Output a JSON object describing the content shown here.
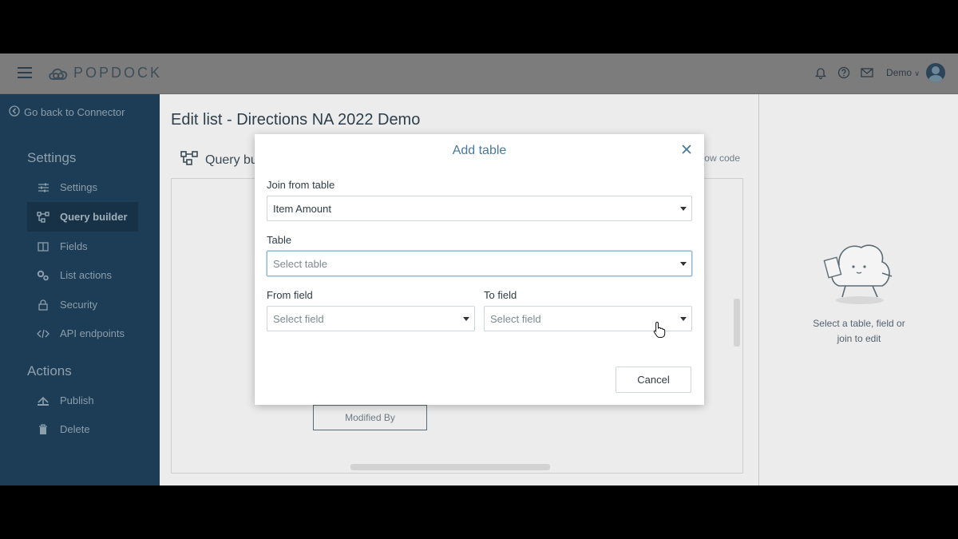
{
  "app": {
    "logo_text": "POPDOCK",
    "user_name": "Demo",
    "user_menu_caret": "∨"
  },
  "sidebar": {
    "back_label": "Go back to Connector",
    "settings_title": "Settings",
    "items": [
      {
        "label": "Settings",
        "icon": "sliders-icon"
      },
      {
        "label": "Query builder",
        "icon": "query-builder-icon",
        "active": true
      },
      {
        "label": "Fields",
        "icon": "columns-icon"
      },
      {
        "label": "List actions",
        "icon": "gears-icon"
      },
      {
        "label": "Security",
        "icon": "lock-icon"
      },
      {
        "label": "API endpoints",
        "icon": "code-icon"
      }
    ],
    "actions_title": "Actions",
    "actions": [
      {
        "label": "Publish",
        "icon": "publish-icon"
      },
      {
        "label": "Delete",
        "icon": "trash-icon"
      }
    ]
  },
  "main": {
    "page_title": "Edit list - Directions NA 2022 Demo",
    "panel_title": "Query bu",
    "show_code": "ow code",
    "node_label": "Modified By"
  },
  "right_panel": {
    "empty_text_line1": "Select a table, field or",
    "empty_text_line2": "join to edit"
  },
  "modal": {
    "title": "Add table",
    "join_from_label": "Join from table",
    "join_from_value": "Item Amount",
    "table_label": "Table",
    "table_placeholder": "Select table",
    "from_field_label": "From field",
    "from_field_placeholder": "Select field",
    "to_field_label": "To field",
    "to_field_placeholder": "Select field",
    "cancel_label": "Cancel"
  },
  "colors": {
    "sidebar_bg": "#1d3c55",
    "modal_title": "#4a7a9a",
    "focus_border": "#8fb7d4"
  }
}
